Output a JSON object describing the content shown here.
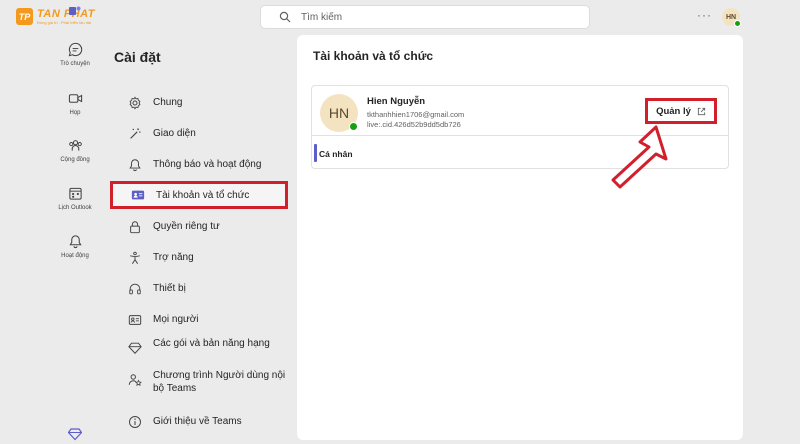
{
  "brand": {
    "name": "TAN PHAT",
    "mark": "TP",
    "tagline": "Đồng giá trị - Phát triển lâu dài"
  },
  "search": {
    "placeholder": "Tìm kiếm"
  },
  "header": {
    "more": "···",
    "avatar_initials": "HN"
  },
  "rail": [
    {
      "label": "Trò chuyện",
      "icon": "chat-icon"
    },
    {
      "label": "Họp",
      "icon": "video-icon"
    },
    {
      "label": "Cộng đồng",
      "icon": "community-icon"
    },
    {
      "label": "Lịch Outlook",
      "icon": "calendar-icon"
    },
    {
      "label": "Hoạt động",
      "icon": "bell-icon"
    }
  ],
  "settings": {
    "title": "Cài đặt",
    "items": [
      {
        "label": "Chung",
        "icon": "gear-icon"
      },
      {
        "label": "Giao diện",
        "icon": "magic-wand-icon"
      },
      {
        "label": "Thông báo và hoạt động",
        "icon": "bell-icon"
      },
      {
        "label": "Tài khoản và tổ chức",
        "icon": "id-card-icon",
        "active": true
      },
      {
        "label": "Quyền riêng tư",
        "icon": "lock-icon"
      },
      {
        "label": "Trợ năng",
        "icon": "accessibility-icon"
      },
      {
        "label": "Thiết bị",
        "icon": "headset-icon"
      },
      {
        "label": "Mọi người",
        "icon": "contact-card-icon"
      },
      {
        "label": "Các gói và bản năng hạng",
        "icon": "diamond-icon"
      },
      {
        "label": "Chương trình Người dùng nội bộ Teams",
        "icon": "person-star-icon"
      },
      {
        "label": "Giới thiệu về Teams",
        "icon": "info-icon"
      }
    ]
  },
  "account": {
    "title": "Tài khoản và tổ chức",
    "avatar_initials": "HN",
    "name": "Hien Nguyễn",
    "email": "tkthanhhien1706@gmail.com",
    "id": "live:.cid.426d52b9dd5db726",
    "manage_label": "Quản lý",
    "section_label": "Cá nhân"
  },
  "colors": {
    "highlight": "#d1202c",
    "accent": "#5b5fc7",
    "brand": "#f39a1e",
    "presence": "#13a10e"
  }
}
